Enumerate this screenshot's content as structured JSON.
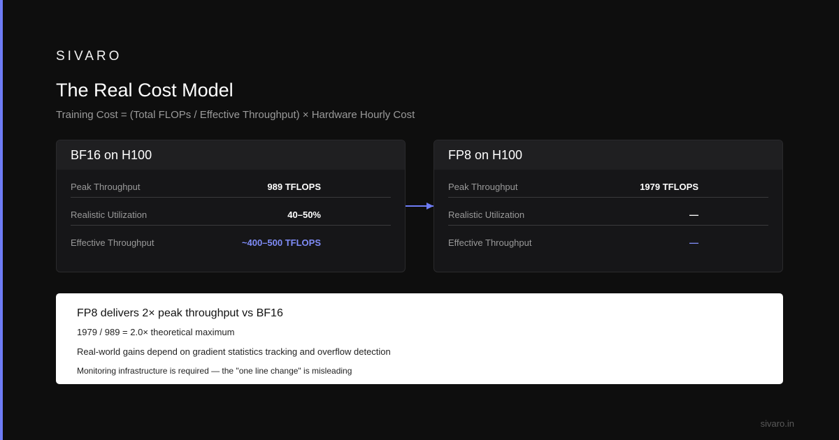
{
  "brand": "SIVARO",
  "title": "The Real Cost Model",
  "subtitle": "Training Cost = (Total FLOPs / Effective Throughput) × Hardware Hourly Cost",
  "colors": {
    "accent": "#6e7cf5",
    "accent_text": "#7f8cf7",
    "background": "#0e0e0e"
  },
  "cards": {
    "bf16": {
      "header": "BF16 on H100",
      "rows": [
        {
          "label": "Peak Throughput",
          "value": "989 TFLOPS"
        },
        {
          "label": "Realistic Utilization",
          "value": "40–50%"
        },
        {
          "label": "Effective Throughput",
          "value": "~400–500 TFLOPS"
        }
      ]
    },
    "fp8": {
      "header": "FP8 on H100",
      "rows": [
        {
          "label": "Peak Throughput",
          "value": "1979 TFLOPS"
        },
        {
          "label": "Realistic Utilization",
          "value": "—"
        },
        {
          "label": "Effective Throughput",
          "value": "—"
        }
      ]
    }
  },
  "note": {
    "title": "FP8 delivers 2× peak throughput vs BF16",
    "line1": "1979 / 989 = 2.0× theoretical maximum",
    "line2": "Real-world gains depend on gradient statistics tracking and overflow detection",
    "line3": "Monitoring infrastructure is required — the \"one line change\" is misleading"
  },
  "footer": "sivaro.in"
}
